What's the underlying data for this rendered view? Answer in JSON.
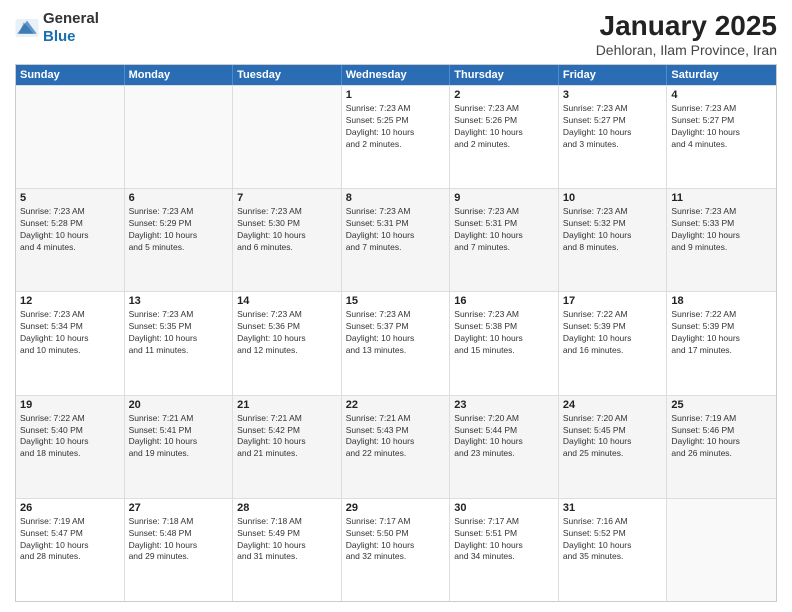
{
  "header": {
    "logo_general": "General",
    "logo_blue": "Blue",
    "title": "January 2025",
    "subtitle": "Dehloran, Ilam Province, Iran"
  },
  "calendar": {
    "days_of_week": [
      "Sunday",
      "Monday",
      "Tuesday",
      "Wednesday",
      "Thursday",
      "Friday",
      "Saturday"
    ],
    "rows": [
      [
        {
          "day": "",
          "info": "",
          "empty": true
        },
        {
          "day": "",
          "info": "",
          "empty": true
        },
        {
          "day": "",
          "info": "",
          "empty": true
        },
        {
          "day": "1",
          "info": "Sunrise: 7:23 AM\nSunset: 5:25 PM\nDaylight: 10 hours\nand 2 minutes."
        },
        {
          "day": "2",
          "info": "Sunrise: 7:23 AM\nSunset: 5:26 PM\nDaylight: 10 hours\nand 2 minutes."
        },
        {
          "day": "3",
          "info": "Sunrise: 7:23 AM\nSunset: 5:27 PM\nDaylight: 10 hours\nand 3 minutes."
        },
        {
          "day": "4",
          "info": "Sunrise: 7:23 AM\nSunset: 5:27 PM\nDaylight: 10 hours\nand 4 minutes."
        }
      ],
      [
        {
          "day": "5",
          "info": "Sunrise: 7:23 AM\nSunset: 5:28 PM\nDaylight: 10 hours\nand 4 minutes."
        },
        {
          "day": "6",
          "info": "Sunrise: 7:23 AM\nSunset: 5:29 PM\nDaylight: 10 hours\nand 5 minutes."
        },
        {
          "day": "7",
          "info": "Sunrise: 7:23 AM\nSunset: 5:30 PM\nDaylight: 10 hours\nand 6 minutes."
        },
        {
          "day": "8",
          "info": "Sunrise: 7:23 AM\nSunset: 5:31 PM\nDaylight: 10 hours\nand 7 minutes."
        },
        {
          "day": "9",
          "info": "Sunrise: 7:23 AM\nSunset: 5:31 PM\nDaylight: 10 hours\nand 7 minutes."
        },
        {
          "day": "10",
          "info": "Sunrise: 7:23 AM\nSunset: 5:32 PM\nDaylight: 10 hours\nand 8 minutes."
        },
        {
          "day": "11",
          "info": "Sunrise: 7:23 AM\nSunset: 5:33 PM\nDaylight: 10 hours\nand 9 minutes."
        }
      ],
      [
        {
          "day": "12",
          "info": "Sunrise: 7:23 AM\nSunset: 5:34 PM\nDaylight: 10 hours\nand 10 minutes."
        },
        {
          "day": "13",
          "info": "Sunrise: 7:23 AM\nSunset: 5:35 PM\nDaylight: 10 hours\nand 11 minutes."
        },
        {
          "day": "14",
          "info": "Sunrise: 7:23 AM\nSunset: 5:36 PM\nDaylight: 10 hours\nand 12 minutes."
        },
        {
          "day": "15",
          "info": "Sunrise: 7:23 AM\nSunset: 5:37 PM\nDaylight: 10 hours\nand 13 minutes."
        },
        {
          "day": "16",
          "info": "Sunrise: 7:23 AM\nSunset: 5:38 PM\nDaylight: 10 hours\nand 15 minutes."
        },
        {
          "day": "17",
          "info": "Sunrise: 7:22 AM\nSunset: 5:39 PM\nDaylight: 10 hours\nand 16 minutes."
        },
        {
          "day": "18",
          "info": "Sunrise: 7:22 AM\nSunset: 5:39 PM\nDaylight: 10 hours\nand 17 minutes."
        }
      ],
      [
        {
          "day": "19",
          "info": "Sunrise: 7:22 AM\nSunset: 5:40 PM\nDaylight: 10 hours\nand 18 minutes."
        },
        {
          "day": "20",
          "info": "Sunrise: 7:21 AM\nSunset: 5:41 PM\nDaylight: 10 hours\nand 19 minutes."
        },
        {
          "day": "21",
          "info": "Sunrise: 7:21 AM\nSunset: 5:42 PM\nDaylight: 10 hours\nand 21 minutes."
        },
        {
          "day": "22",
          "info": "Sunrise: 7:21 AM\nSunset: 5:43 PM\nDaylight: 10 hours\nand 22 minutes."
        },
        {
          "day": "23",
          "info": "Sunrise: 7:20 AM\nSunset: 5:44 PM\nDaylight: 10 hours\nand 23 minutes."
        },
        {
          "day": "24",
          "info": "Sunrise: 7:20 AM\nSunset: 5:45 PM\nDaylight: 10 hours\nand 25 minutes."
        },
        {
          "day": "25",
          "info": "Sunrise: 7:19 AM\nSunset: 5:46 PM\nDaylight: 10 hours\nand 26 minutes."
        }
      ],
      [
        {
          "day": "26",
          "info": "Sunrise: 7:19 AM\nSunset: 5:47 PM\nDaylight: 10 hours\nand 28 minutes."
        },
        {
          "day": "27",
          "info": "Sunrise: 7:18 AM\nSunset: 5:48 PM\nDaylight: 10 hours\nand 29 minutes."
        },
        {
          "day": "28",
          "info": "Sunrise: 7:18 AM\nSunset: 5:49 PM\nDaylight: 10 hours\nand 31 minutes."
        },
        {
          "day": "29",
          "info": "Sunrise: 7:17 AM\nSunset: 5:50 PM\nDaylight: 10 hours\nand 32 minutes."
        },
        {
          "day": "30",
          "info": "Sunrise: 7:17 AM\nSunset: 5:51 PM\nDaylight: 10 hours\nand 34 minutes."
        },
        {
          "day": "31",
          "info": "Sunrise: 7:16 AM\nSunset: 5:52 PM\nDaylight: 10 hours\nand 35 minutes."
        },
        {
          "day": "",
          "info": "",
          "empty": true
        }
      ]
    ]
  }
}
